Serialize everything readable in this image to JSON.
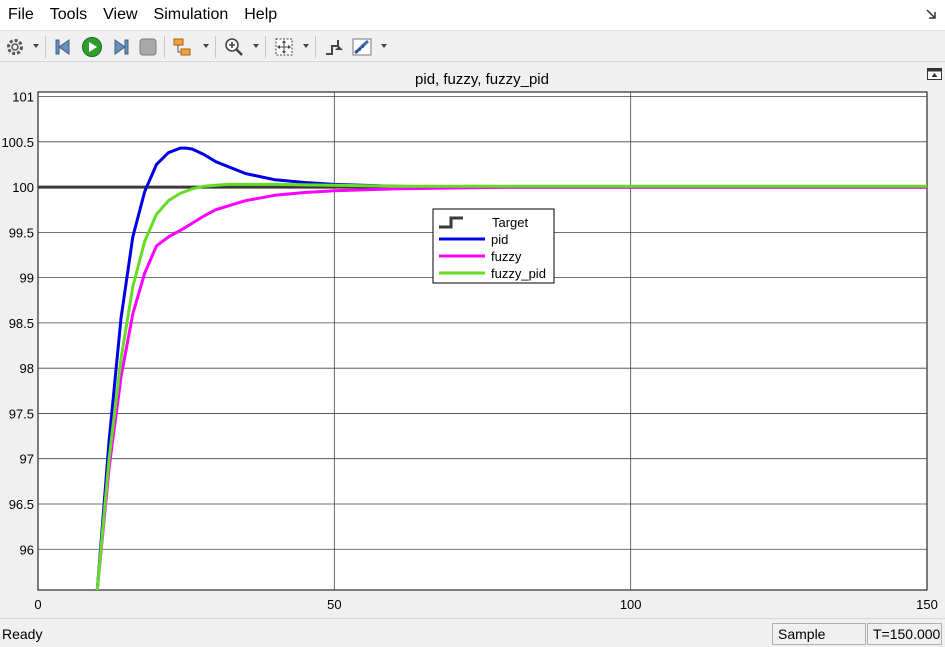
{
  "menu": {
    "items": [
      "File",
      "Tools",
      "View",
      "Simulation",
      "Help"
    ]
  },
  "toolbar": {
    "buttons": [
      {
        "name": "configuration-properties-icon"
      },
      {
        "name": "step-back-icon"
      },
      {
        "name": "run-icon"
      },
      {
        "name": "step-forward-icon"
      },
      {
        "name": "stop-icon"
      },
      {
        "name": "highlight-in-model-icon"
      },
      {
        "name": "zoom-in-icon"
      },
      {
        "name": "zoom-to-fit-icon"
      },
      {
        "name": "triggers-icon"
      },
      {
        "name": "cursor-measurements-icon"
      }
    ]
  },
  "status": {
    "ready": "Ready",
    "mode": "Sample based",
    "time": "T=150.000"
  },
  "colors": {
    "target": "#3a3a3a",
    "pid": "#0000e6",
    "fuzzy": "#ff00ff",
    "fuzzy_pid": "#66dd22",
    "grid": "#444444",
    "axes_bg": "#ffffff"
  },
  "chart_data": {
    "type": "line",
    "title": "pid, fuzzy, fuzzy_pid",
    "xlim": [
      0,
      150
    ],
    "ylim": [
      95.55,
      101.05
    ],
    "xticks": [
      0,
      50,
      100,
      150
    ],
    "yticks": [
      96,
      96.5,
      97,
      97.5,
      98,
      98.5,
      99,
      99.5,
      100,
      100.5,
      101
    ],
    "xtick_labels": [
      "0",
      "50",
      "100",
      "150"
    ],
    "ytick_labels": [
      "96",
      "96.5",
      "97",
      "97.5",
      "98",
      "98.5",
      "99",
      "99.5",
      "100",
      "100.5",
      "101"
    ],
    "grid": true,
    "legend_position": "center",
    "series": [
      {
        "name": "Target",
        "color": "#3a3a3a",
        "x": [
          0,
          150
        ],
        "y": [
          100,
          100
        ]
      },
      {
        "name": "pid",
        "color": "#0000e6",
        "x": [
          10,
          12,
          14,
          16,
          18,
          20,
          22,
          24,
          25,
          26,
          28,
          30,
          35,
          40,
          45,
          50,
          60,
          70,
          80,
          100,
          150
        ],
        "y": [
          95.55,
          97.2,
          98.55,
          99.45,
          99.95,
          100.25,
          100.38,
          100.43,
          100.43,
          100.42,
          100.36,
          100.28,
          100.15,
          100.08,
          100.05,
          100.03,
          100.01,
          100.0,
          100.0,
          100.0,
          100.0
        ]
      },
      {
        "name": "fuzzy",
        "color": "#ff00ff",
        "x": [
          10,
          12,
          14,
          16,
          18,
          20,
          22,
          24,
          26,
          28,
          30,
          35,
          40,
          45,
          50,
          60,
          70,
          80,
          100,
          150
        ],
        "y": [
          95.55,
          96.9,
          97.9,
          98.6,
          99.05,
          99.35,
          99.45,
          99.52,
          99.6,
          99.68,
          99.75,
          99.85,
          99.91,
          99.94,
          99.96,
          99.98,
          99.99,
          100.0,
          100.0,
          100.0
        ]
      },
      {
        "name": "fuzzy_pid",
        "color": "#66dd22",
        "x": [
          10,
          12,
          14,
          16,
          18,
          20,
          22,
          24,
          26,
          28,
          30,
          32,
          35,
          40,
          50,
          60,
          80,
          100,
          150
        ],
        "y": [
          95.55,
          97.0,
          98.1,
          98.9,
          99.4,
          99.7,
          99.85,
          99.93,
          99.98,
          100.01,
          100.02,
          100.03,
          100.03,
          100.03,
          100.02,
          100.01,
          100.01,
          100.01,
          100.01
        ]
      }
    ]
  }
}
